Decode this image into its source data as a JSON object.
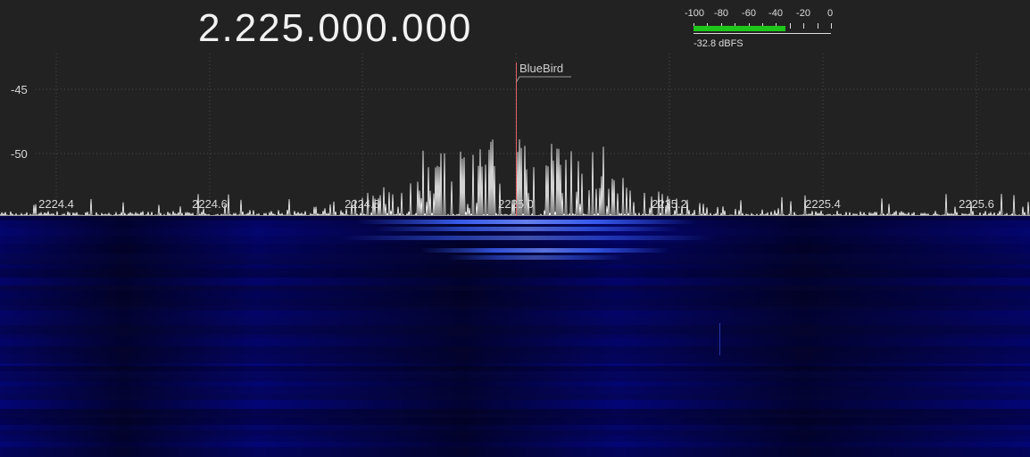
{
  "frequency_display": "2.225.000.000",
  "level_meter": {
    "scale_labels": [
      "-100",
      "-80",
      "-60",
      "-40",
      "-20",
      "0"
    ],
    "level_dbfs": -32.8,
    "readout": "-32.8 dBFS",
    "fill_color": "#1fc61a"
  },
  "spectrum": {
    "y_tick_labels": [
      "-45",
      "-50"
    ],
    "x_tick_labels": [
      "2224.4",
      "2224.6",
      "2224.8",
      "2225.0",
      "2225.2",
      "2225.4",
      "2225.6"
    ],
    "trace_color": "#ffffff",
    "background_color": "#232222"
  },
  "marker": {
    "label": "BlueBird",
    "color": "#e0606a"
  },
  "waterfall": {
    "background_color": "#060630",
    "signal_color": "#3c63ff"
  }
}
